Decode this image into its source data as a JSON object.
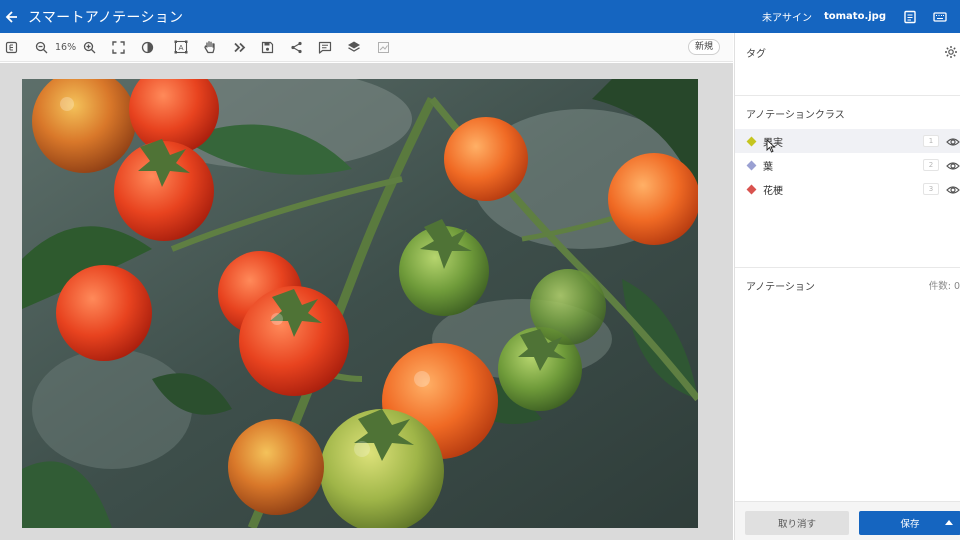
{
  "header": {
    "title": "スマートアノテーション",
    "assign_status": "未アサイン",
    "filename": "tomato.jpg",
    "bg_color": "#1565c0"
  },
  "toolbar": {
    "zoom": "16%",
    "new_label": "新規",
    "icons": [
      "export-icon",
      "zoom-out-icon",
      "zoom-in-icon",
      "fit-screen-icon",
      "brightness-icon",
      "text-select-icon",
      "hand-icon",
      "next-icon",
      "save-icon",
      "share-icon",
      "comment-icon",
      "layers-icon",
      "chart-icon"
    ]
  },
  "panel": {
    "tags_title": "タグ",
    "classes_title": "アノテーションクラス",
    "annotations_title": "アノテーション",
    "count_label": "件数: 0",
    "classes": [
      {
        "label": "果実",
        "count": "1",
        "color": "#c5c51f"
      },
      {
        "label": "葉",
        "count": "2",
        "color": "#9aa0d2"
      },
      {
        "label": "花梗",
        "count": "3",
        "color": "#d9534f"
      }
    ],
    "cancel_label": "取り消す",
    "save_label": "保存"
  }
}
